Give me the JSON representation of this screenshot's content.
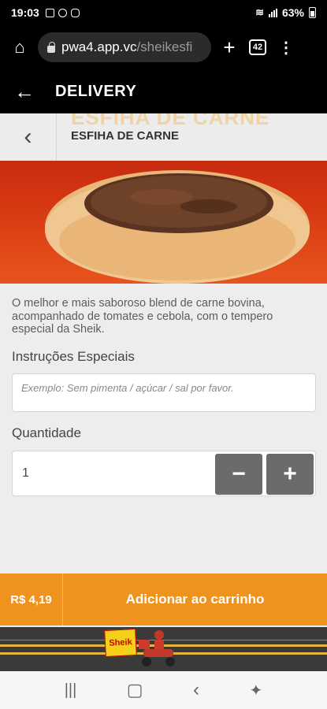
{
  "status_bar": {
    "time": "19:03",
    "battery": "63%"
  },
  "browser": {
    "host": "pwa4.app.vc",
    "path": "/sheikesfi",
    "tab_count": "42"
  },
  "app_header": {
    "title": "DELIVERY"
  },
  "product": {
    "background_title": "ESFIHA DE CARNE",
    "name": "ESFIHA DE CARNE",
    "description": "O melhor e mais saboroso blend de carne bovina, acompanhado de tomates e cebola, com o tempero especial da Sheik."
  },
  "form": {
    "instructions_label": "Instruções Especiais",
    "instructions_placeholder": "Exemplo: Sem pimenta / açúcar / sal por favor.",
    "quantity_label": "Quantidade",
    "quantity_value": "1",
    "minus": "−",
    "plus": "+"
  },
  "cart": {
    "price": "R$ 4,19",
    "add_label": "Adicionar ao carrinho"
  },
  "banner": {
    "logo_text": "Sheik"
  },
  "icons": {
    "back": "arrow-left-icon",
    "home": "home-icon",
    "new_tab": "plus-icon",
    "menu": "more-vert-icon"
  },
  "colors": {
    "accent": "#f0931e",
    "header": "#000000",
    "stepper": "#6b6b6b"
  }
}
